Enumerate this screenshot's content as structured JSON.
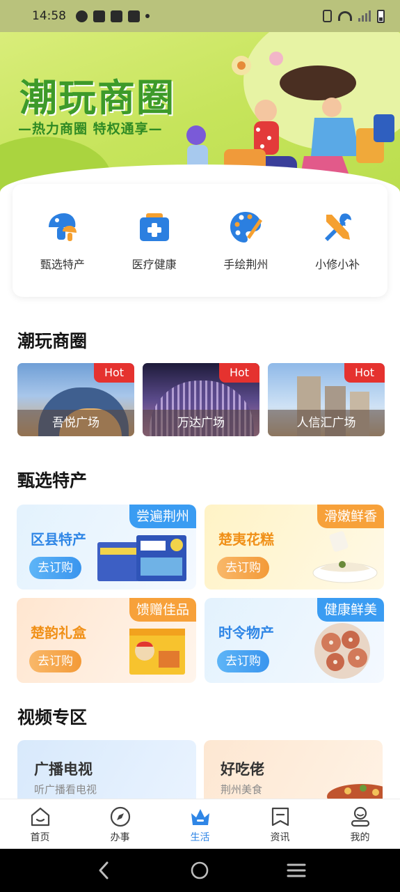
{
  "status_bar": {
    "time": "14:58"
  },
  "hero": {
    "title": "潮玩商圈",
    "subtitle": "—热力商圈 特权通享—"
  },
  "quick_categories": [
    {
      "label": "甄选特产",
      "icon": "mushroom-icon"
    },
    {
      "label": "医疗健康",
      "icon": "medical-kit-icon"
    },
    {
      "label": "手绘荆州",
      "icon": "palette-icon"
    },
    {
      "label": "小修小补",
      "icon": "tools-icon"
    }
  ],
  "sections": {
    "malls_title": "潮玩商圈",
    "specialty_title": "甄选特产",
    "video_title": "视频专区"
  },
  "malls": [
    {
      "name": "吾悦广场",
      "badge": "Hot"
    },
    {
      "name": "万达广场",
      "badge": "Hot"
    },
    {
      "name": "人信汇广场",
      "badge": "Hot"
    }
  ],
  "specialties": [
    {
      "title": "区县特产",
      "tag": "尝遍荆州",
      "button": "去订购",
      "theme": "blue"
    },
    {
      "title": "楚夷花糕",
      "tag": "滑嫩鲜香",
      "button": "去订购",
      "theme": "yellow"
    },
    {
      "title": "楚韵礼盒",
      "tag": "馈赠佳品",
      "button": "去订购",
      "theme": "orange"
    },
    {
      "title": "时令物产",
      "tag": "健康鲜美",
      "button": "去订购",
      "theme": "blue"
    }
  ],
  "videos": [
    {
      "title": "广播电视",
      "subtitle": "听广播看电视"
    },
    {
      "title": "好吃佬",
      "subtitle": "荆州美食"
    }
  ],
  "tabs": [
    {
      "label": "首页",
      "icon": "home-icon",
      "active": false
    },
    {
      "label": "办事",
      "icon": "compass-icon",
      "active": false
    },
    {
      "label": "生活",
      "icon": "life-icon",
      "active": true
    },
    {
      "label": "资讯",
      "icon": "news-icon",
      "active": false
    },
    {
      "label": "我的",
      "icon": "profile-icon",
      "active": false
    }
  ],
  "colors": {
    "accent_blue": "#2f86e6",
    "hot_red": "#e5322f",
    "hero_green": "#3d9a2a",
    "tag_orange": "#f7a13a"
  }
}
